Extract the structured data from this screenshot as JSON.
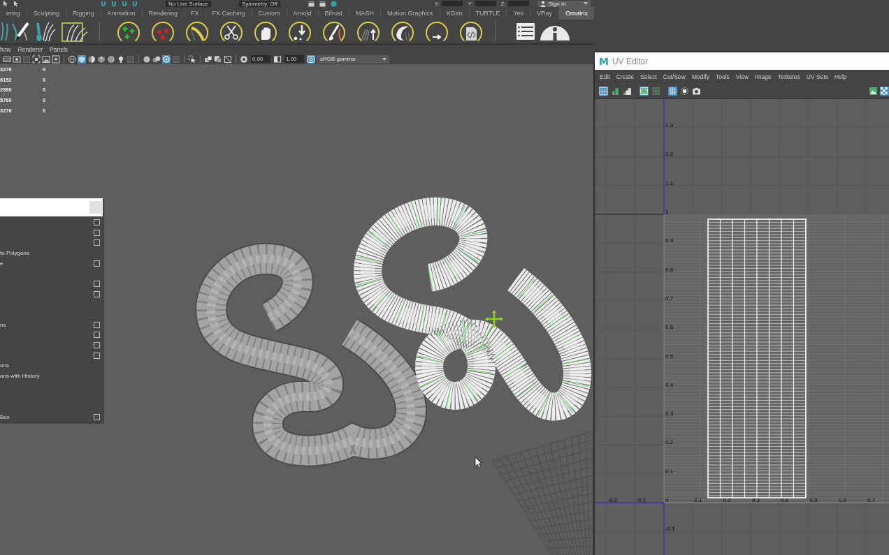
{
  "status_line": {
    "live_surface": "No Live Surface",
    "symmetry": "Symmetry: Off",
    "coordinates": [
      "X:",
      "Y:",
      "Z:"
    ],
    "sign_in": "Sign In"
  },
  "shelf": {
    "tabs": [
      {
        "label": "ering",
        "selected": false
      },
      {
        "label": "Sculpting",
        "selected": false
      },
      {
        "label": "Rigging",
        "selected": false
      },
      {
        "label": "Animation",
        "selected": false
      },
      {
        "label": "Rendering",
        "selected": false
      },
      {
        "label": "FX",
        "selected": false
      },
      {
        "label": "FX Caching",
        "selected": false
      },
      {
        "label": "Custom",
        "selected": false
      },
      {
        "label": "Arnold",
        "selected": false
      },
      {
        "label": "Bifrost",
        "selected": false
      },
      {
        "label": "MASH",
        "selected": false
      },
      {
        "label": "Motion Graphics",
        "selected": false
      },
      {
        "label": "XGen",
        "selected": false
      },
      {
        "label": "TURTLE",
        "selected": false
      },
      {
        "label": "Yeti",
        "selected": false
      },
      {
        "label": "VRay",
        "selected": false
      },
      {
        "label": "Ornatrix",
        "selected": true
      }
    ]
  },
  "panel_menu": [
    "how",
    "Renderer",
    "Panels"
  ],
  "panel_toolbar": {
    "groups": [
      [
        {
          "kind": "film",
          "on": false
        },
        {
          "kind": "gate",
          "on": false
        },
        {
          "kind": "blank",
          "on": false
        },
        {
          "kind": "corners",
          "on": false
        },
        {
          "kind": "image",
          "on": false
        },
        {
          "kind": "frame-cross",
          "on": false
        }
      ],
      [
        {
          "kind": "wire-sphere",
          "on": false
        },
        {
          "kind": "cube",
          "on": true
        },
        {
          "kind": "shade-sphere",
          "on": false
        },
        {
          "kind": "checker-cube",
          "on": false
        },
        {
          "kind": "dotted-sphere",
          "on": false
        },
        {
          "kind": "bulb",
          "on": false
        },
        {
          "kind": "blank",
          "on": false
        }
      ],
      [
        {
          "kind": "sphere",
          "on": false
        },
        {
          "kind": "two-spheres",
          "on": false
        },
        {
          "kind": "ring",
          "on": true
        },
        {
          "kind": "blank",
          "on": false
        }
      ],
      [
        {
          "kind": "select",
          "on": false
        }
      ],
      [
        {
          "kind": "stacked-squares",
          "on": false
        },
        {
          "kind": "overlap-squares",
          "on": false
        },
        {
          "kind": "crossed-box",
          "on": false
        }
      ]
    ],
    "exposure": "0.00",
    "gamma": "1.00",
    "color_management_on": true,
    "color_space": "sRGB gamma"
  },
  "hud": [
    {
      "column_1": "3276",
      "column_2": "0"
    },
    {
      "column_1": "6152",
      "column_2": "0"
    },
    {
      "column_1": "2880",
      "column_2": "0"
    },
    {
      "column_1": "5760",
      "column_2": "0"
    },
    {
      "column_1": "3276",
      "column_2": "0"
    }
  ],
  "torn_off_menu": {
    "items": [
      {
        "option_box": true
      },
      {
        "option_box": true
      },
      {
        "option_box": true
      },
      {
        "label": "to Polygons",
        "option_box": false
      },
      {
        "label": "e",
        "option_box": true
      },
      {
        "option_box": false
      },
      {
        "option_box": true
      },
      {
        "option_box": true
      },
      {
        "option_box": false
      },
      {
        "option_box": false
      },
      {
        "label": "ns",
        "option_box": true
      },
      {
        "option_box": true
      },
      {
        "option_box": true
      },
      {
        "option_box": true
      },
      {
        "label": "ons",
        "option_box": false
      },
      {
        "label": "ons with History",
        "option_box": false
      },
      {
        "option_box": false
      },
      {
        "option_box": false
      },
      {
        "option_box": false
      },
      {
        "label": "Box",
        "option_box": true
      }
    ]
  },
  "uv_editor": {
    "logo": "M",
    "title": "UV Editor",
    "menu": [
      "Edit",
      "Create",
      "Select",
      "Cut/Sew",
      "Modify",
      "Tools",
      "View",
      "Image",
      "Textures",
      "UV Sets",
      "Help"
    ],
    "toolbar": [
      [
        {
          "kind": "uv-grid",
          "on": true
        },
        {
          "kind": "bars",
          "on": false
        },
        {
          "kind": "stairs",
          "on": false
        }
      ],
      [
        {
          "kind": "frame",
          "on": true
        },
        {
          "kind": "grid-square",
          "on": false
        }
      ],
      [
        {
          "kind": "grid",
          "on": true
        },
        {
          "kind": "dotted-circle",
          "on": false
        },
        {
          "kind": "camera",
          "on": false
        }
      ]
    ],
    "toolbar_right": [
      {
        "kind": "image",
        "on": false
      },
      {
        "kind": "checker",
        "on": true
      }
    ],
    "v_labels": [
      "1.3",
      "1.2",
      "1.1",
      "1",
      "0.9",
      "0.8",
      "0.7",
      "0.6",
      "0.5",
      "0.4",
      "0.3",
      "0.2",
      "0.1",
      "0",
      "-0.1"
    ],
    "u_labels_negative": [
      "-0.2",
      "-0.1"
    ],
    "u_labels_positive": [
      "0.1",
      "0.2",
      "0.3",
      "0.4",
      "0.5",
      "0.6",
      "0.7"
    ]
  }
}
